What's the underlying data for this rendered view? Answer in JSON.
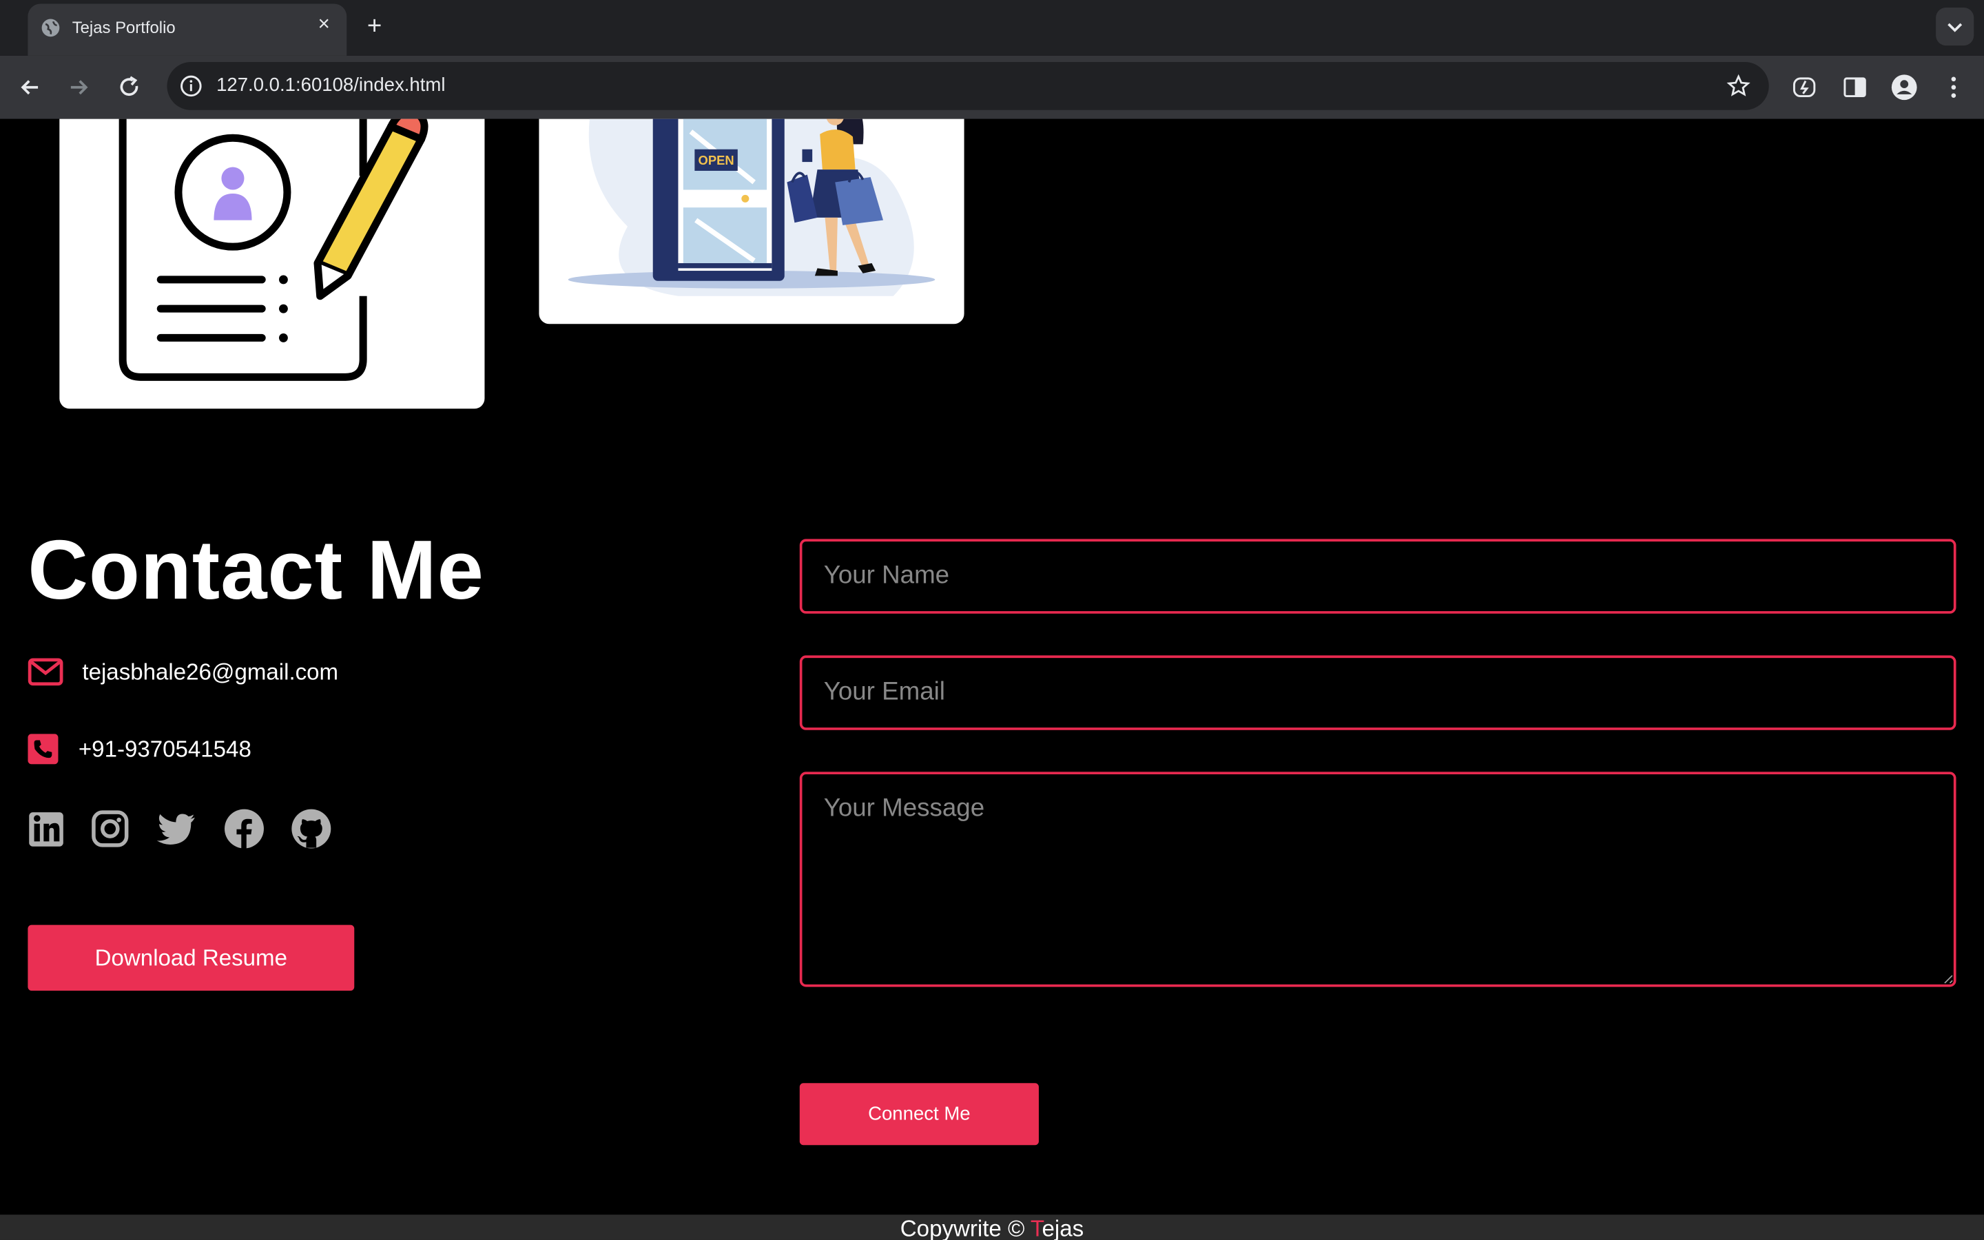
{
  "browser": {
    "tab_title": "Tejas Portfolio",
    "tab_close": "×",
    "new_tab": "+",
    "url": "127.0.0.1:60108/index.html"
  },
  "contact": {
    "title": "Contact Me",
    "email": "tejasbhale26@gmail.com",
    "phone": "+91-9370541548",
    "download_label": "Download Resume",
    "socials": [
      "linkedin-icon",
      "instagram-icon",
      "twitter-icon",
      "facebook-icon",
      "github-icon"
    ]
  },
  "form": {
    "name_placeholder": "Your Name",
    "email_placeholder": "Your Email",
    "message_placeholder": "Your Message",
    "submit_label": "Connect Me"
  },
  "illustration": {
    "sign_text": "OPEN"
  },
  "footer": {
    "prefix": "Copywrite © ",
    "accent_letter": "T",
    "rest": "ejas"
  },
  "colors": {
    "accent": "#ea2f53",
    "background": "#000000",
    "icon_gray": "#b0b0b0"
  }
}
